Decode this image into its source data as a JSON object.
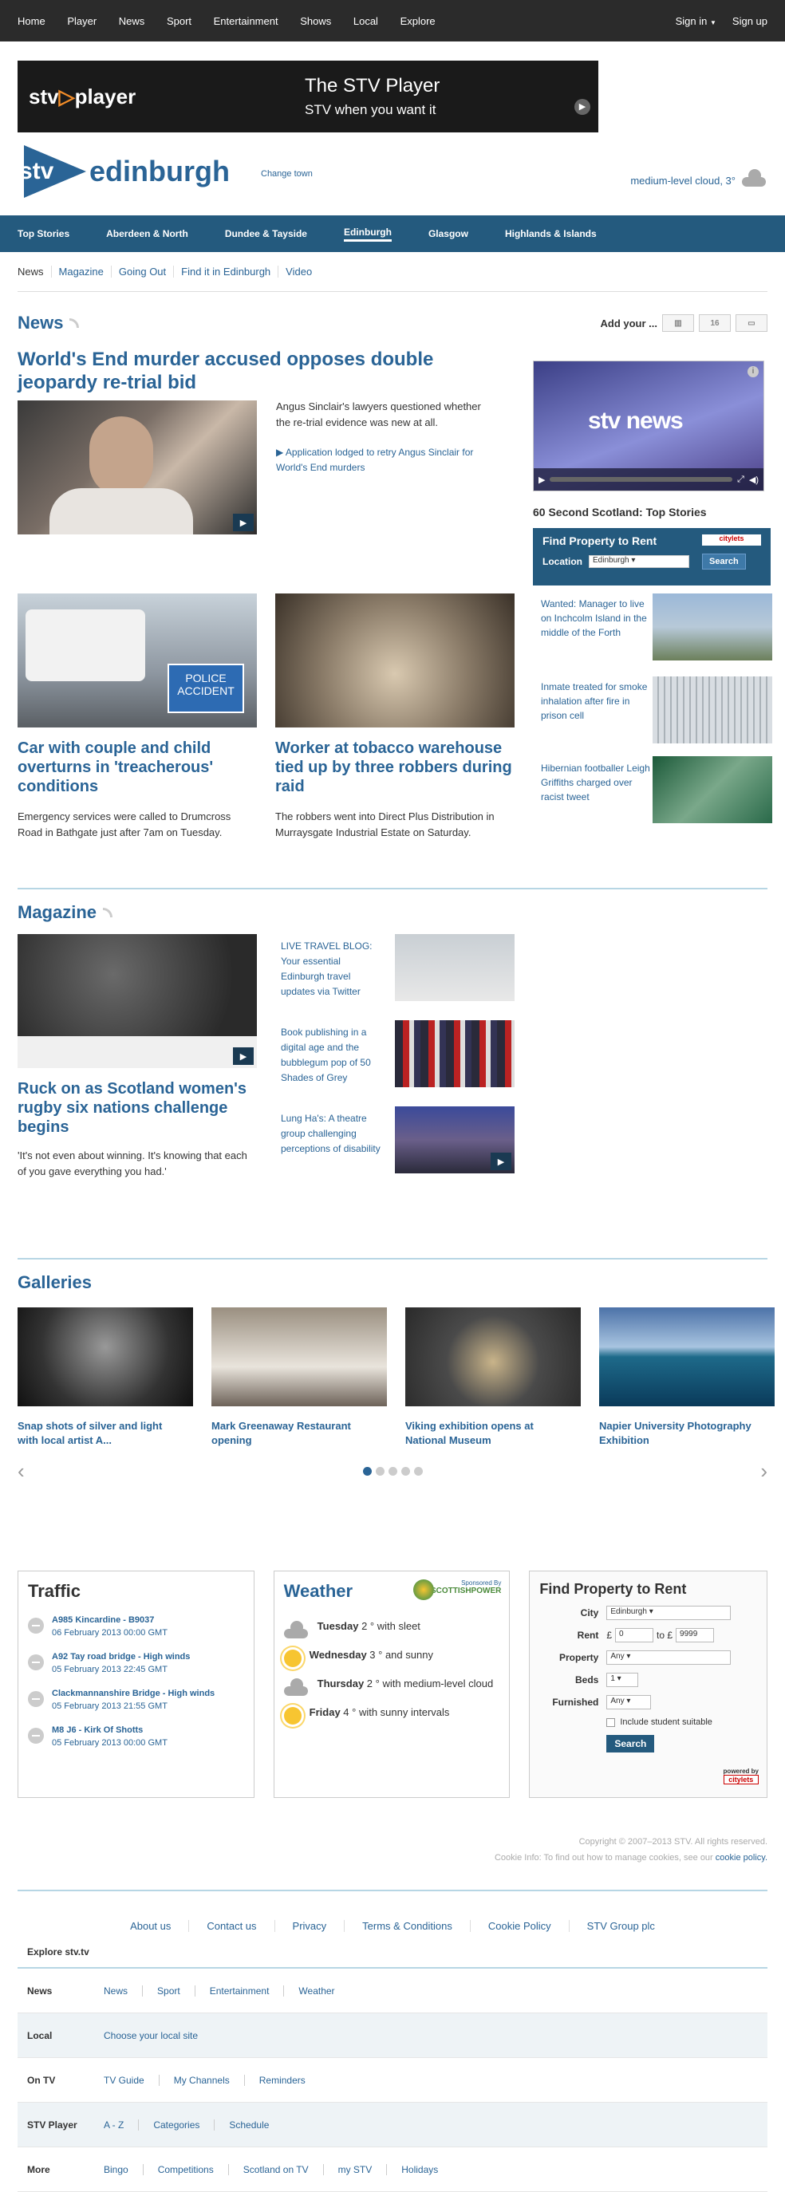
{
  "topnav": {
    "items": [
      "Home",
      "Player",
      "News",
      "Sport",
      "Entertainment",
      "Shows",
      "Local",
      "Explore"
    ],
    "signin": "Sign in",
    "signup": "Sign up"
  },
  "banner": {
    "logo_left": "stv",
    "logo_right": "player",
    "title": "The STV Player",
    "subtitle": "STV when you want it"
  },
  "brand": {
    "logo": "stv",
    "city": "edinburgh",
    "change": "Change town",
    "weather": "medium-level cloud, 3°"
  },
  "regions": [
    "Top Stories",
    "Aberdeen & North",
    "Dundee & Tayside",
    "Edinburgh",
    "Glasgow",
    "Highlands & Islands"
  ],
  "subnav": [
    "News",
    "Magazine",
    "Going Out",
    "Find it in Edinburgh",
    "Video"
  ],
  "news": {
    "heading": "News",
    "add_your": "Add your ...",
    "add_icons": [
      "16"
    ],
    "lead": {
      "title": "World's End murder accused opposes double jeopardy re-trial bid",
      "desc": "Angus Sinclair's lawyers questioned whether the re-trial evidence was new at all.",
      "link": "Application lodged to retry Angus Sinclair for World's End murders"
    },
    "video": {
      "brand": "stv news",
      "title": "60 Second Scotland: Top Stories"
    },
    "property": {
      "title": "Find Property to Rent",
      "location_label": "Location",
      "location_value": "Edinburgh",
      "search": "Search",
      "partner": "citylets"
    },
    "story1": {
      "title": "Car with couple and child overturns in 'treacherous' conditions",
      "desc": "Emergency services were called to Drumcross Road in Bathgate just after 7am on Tuesday.",
      "sign1": "POLICE",
      "sign2": "ACCIDENT"
    },
    "story2": {
      "title": "Worker at tobacco warehouse tied up by three robbers during raid",
      "desc": "The robbers went into Direct Plus Distribution in Murraysgate Industrial Estate on Saturday."
    },
    "side": [
      "Wanted: Manager to live on Inchcolm Island in the middle of the Forth",
      "Inmate treated for smoke inhalation after fire in prison cell",
      "Hibernian footballer Leigh Griffiths charged over racist tweet"
    ]
  },
  "magazine": {
    "heading": "Magazine",
    "lead": {
      "title": "Ruck on as Scotland women's rugby six nations challenge begins",
      "desc": "'It's not even about winning. It's knowing that each of you gave everything you had.'"
    },
    "links": [
      "LIVE TRAVEL BLOG: Your essential Edinburgh travel updates via Twitter",
      "Book publishing in a digital age and the bubblegum pop of 50 Shades of Grey",
      "Lung Ha's: A theatre group challenging perceptions of disability"
    ]
  },
  "galleries": {
    "heading": "Galleries",
    "items": [
      "Snap shots of silver and light with local artist A...",
      "Mark Greenaway Restaurant opening",
      "Viking exhibition opens at National Museum",
      "Napier University Photography Exhibition"
    ]
  },
  "traffic": {
    "heading": "Traffic",
    "items": [
      {
        "title": "A985 Kincardine - B9037",
        "date": "06 February 2013 00:00 GMT"
      },
      {
        "title": "A92 Tay road bridge - High winds",
        "date": "05 February 2013 22:45 GMT"
      },
      {
        "title": "Clackmannanshire Bridge - High winds",
        "date": "05 February 2013 21:55 GMT"
      },
      {
        "title": "M8 J6 - Kirk Of Shotts",
        "date": "05 February 2013 00:00 GMT"
      }
    ]
  },
  "weather": {
    "heading": "Weather",
    "sponsor_top": "Sponsored By",
    "sponsor": "SCOTTISHPOWER",
    "days": [
      {
        "day": "Tuesday",
        "rest": " 2 ° with sleet",
        "icon": "cloud"
      },
      {
        "day": "Wednesday",
        "rest": " 3 ° and sunny",
        "icon": "sun"
      },
      {
        "day": "Thursday",
        "rest": " 2 ° with medium-level cloud",
        "icon": "cloud"
      },
      {
        "day": "Friday",
        "rest": " 4 ° with sunny intervals",
        "icon": "sun"
      }
    ]
  },
  "findprop": {
    "heading": "Find Property to Rent",
    "city_label": "City",
    "city": "Edinburgh",
    "rent_label": "Rent",
    "currency": "£",
    "rent_min": "0",
    "to": "to £",
    "rent_max": "9999",
    "property_label": "Property",
    "property": "Any",
    "beds_label": "Beds",
    "beds": "1",
    "furnished_label": "Furnished",
    "furnished": "Any",
    "student": "Include student suitable",
    "search": "Search",
    "powered": "powered by",
    "partner": "citylets"
  },
  "footer": {
    "copyright": "Copyright © 2007–2013 STV. All rights reserved.",
    "cookie_text": "Cookie Info: To find out how to manage cookies, see our ",
    "cookie_link": "cookie policy.",
    "links": [
      "About us",
      "Contact us",
      "Privacy",
      "Terms & Conditions",
      "Cookie Policy",
      "STV Group plc"
    ],
    "explore": "Explore stv.tv",
    "rows": [
      {
        "head": "News",
        "links": [
          "News",
          "Sport",
          "Entertainment",
          "Weather"
        ]
      },
      {
        "head": "Local",
        "links": [
          "Choose your local site"
        ]
      },
      {
        "head": "On TV",
        "links": [
          "TV Guide",
          "My Channels",
          "Reminders"
        ]
      },
      {
        "head": "STV Player",
        "links": [
          "A - Z",
          "Categories",
          "Schedule"
        ]
      },
      {
        "head": "More",
        "links": [
          "Bingo",
          "Competitions",
          "Scotland on TV",
          "my STV",
          "Holidays"
        ]
      }
    ]
  }
}
